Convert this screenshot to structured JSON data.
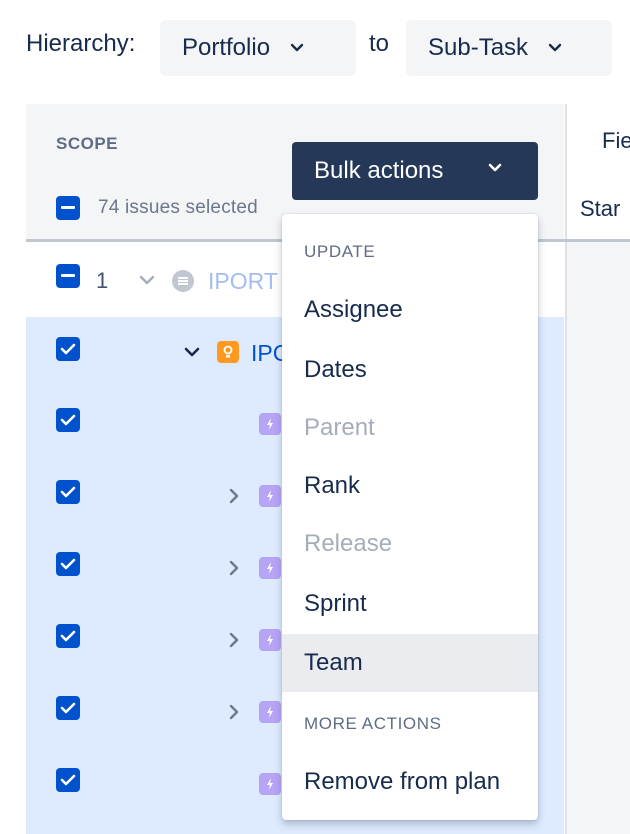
{
  "hierarchy": {
    "label": "Hierarchy:",
    "from_value": "Portfolio",
    "to_label": "to",
    "to_value": "Sub-Task"
  },
  "scope": {
    "title": "SCOPE",
    "selected_text": "74 issues selected",
    "bulk_actions_label": "Bulk actions"
  },
  "right_panel": {
    "fields_label": "Fie",
    "start_label": "Star"
  },
  "rows": {
    "parent_number": "1",
    "parent_key": "IPORT",
    "child_key": "IPC"
  },
  "menu": {
    "update_heading": "UPDATE",
    "items": [
      {
        "label": "Assignee",
        "disabled": false
      },
      {
        "label": "Dates",
        "disabled": false
      },
      {
        "label": "Parent",
        "disabled": true
      },
      {
        "label": "Rank",
        "disabled": false
      },
      {
        "label": "Release",
        "disabled": true
      },
      {
        "label": "Sprint",
        "disabled": false
      },
      {
        "label": "Team",
        "disabled": false,
        "hovered": true
      }
    ],
    "more_heading": "MORE ACTIONS",
    "remove_label": "Remove from plan"
  },
  "colors": {
    "primary": "#0052cc",
    "bulk_button_bg": "#253858",
    "selected_row_bg": "#deebff",
    "subtask_icon": "#b8a4f5",
    "idea_icon": "#ff991f"
  }
}
